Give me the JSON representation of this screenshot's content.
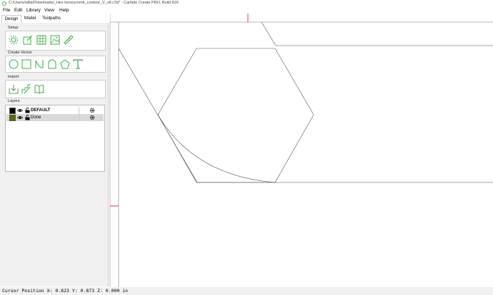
{
  "window": {
    "title": "C:/Users/willa/Downloads/_Hex honeycomb_contour_V_v8.c2d* - Carbide Create PRO, Build 816",
    "icon": "carbide-app-icon"
  },
  "menu": [
    {
      "label": "File",
      "mnemonic": "F"
    },
    {
      "label": "Edit",
      "mnemonic": "E"
    },
    {
      "label": "Library"
    },
    {
      "label": "View"
    },
    {
      "label": "Help",
      "mnemonic": "H"
    }
  ],
  "tabs": [
    {
      "label": "Design",
      "active": true
    },
    {
      "label": "Model",
      "active": false
    },
    {
      "label": "Toolpaths",
      "active": false
    }
  ],
  "sections": {
    "setup": {
      "label": "Setup",
      "tools": [
        "job-setup-icon",
        "edit-icon",
        "grid-icon",
        "image-icon",
        "ruler-icon"
      ]
    },
    "create_vector": {
      "label": "Create Vector",
      "tools": [
        "circle-icon",
        "rectangle-icon",
        "curve-icon",
        "polygon-icon",
        "pentagon-icon",
        "text-icon"
      ]
    },
    "import": {
      "label": "Import",
      "tools": [
        "import-svg-icon",
        "import-image-icon",
        "import-library-icon"
      ]
    },
    "layers": {
      "label": "Layers",
      "items": [
        {
          "name": "DEFAULT",
          "color": "#000000",
          "bold": true,
          "selected": false
        },
        {
          "name": "Done",
          "color": "#666600",
          "bold": false,
          "selected": true
        }
      ]
    }
  },
  "status": {
    "text": "Cursor Position X: 0.823 Y: 0.873 Z: 0.000 in"
  },
  "colors": {
    "accent": "#3cb043",
    "marker": "#e53935",
    "geometry": "#555555"
  }
}
